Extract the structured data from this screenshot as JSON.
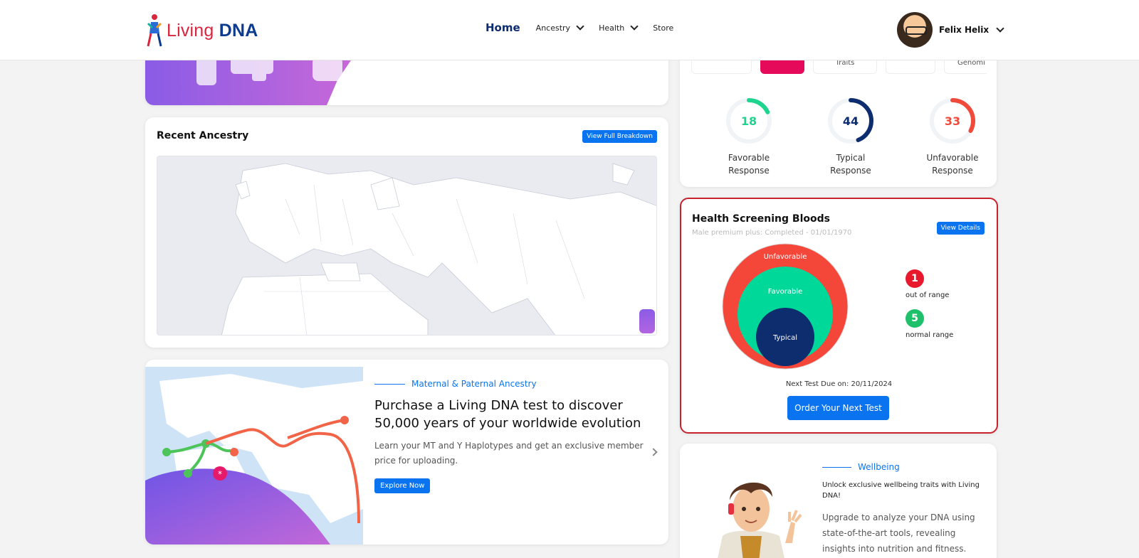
{
  "brand": {
    "word1": "Living",
    "word2": "DNA"
  },
  "nav": {
    "home": "Home",
    "ancestry": "Ancestry",
    "health": "Health",
    "store": "Store"
  },
  "user": {
    "name": "Felix Helix"
  },
  "recent_ancestry": {
    "title": "Recent Ancestry",
    "button": "View Full Breakdown"
  },
  "maternal": {
    "eyebrow": "Maternal & Paternal Ancestry",
    "title": "Purchase a Living DNA test to discover 50,000 years of your worldwide evolution",
    "description": "Learn your MT and Y Haplotypes and get an exclusive member price for uploading.",
    "button": "Explore Now"
  },
  "responses": {
    "tabs": [
      "",
      "",
      "Traits",
      "",
      "Genomi"
    ],
    "items": [
      {
        "value": "18",
        "label_line1": "Favorable",
        "label_line2": "Response",
        "color": "#1ed48f",
        "fraction": 0.18
      },
      {
        "value": "44",
        "label_line1": "Typical",
        "label_line2": "Response",
        "color": "#0d2d6e",
        "fraction": 0.44
      },
      {
        "value": "33",
        "label_line1": "Unfavorable",
        "label_line2": "Response",
        "color": "#f04a3b",
        "fraction": 0.33
      }
    ]
  },
  "health_screening": {
    "title": "Health Screening Bloods",
    "subtitle": "Male premium plus: Completed - 01/01/1970",
    "button": "View Details",
    "circles": {
      "outer": "Unfavorable",
      "middle": "Favorable",
      "inner": "Typical"
    },
    "out_of_range": {
      "count": "1",
      "label": "out of range",
      "color": "#e8192c"
    },
    "normal_range": {
      "count": "5",
      "label": "normal range",
      "color": "#1fc06b"
    },
    "next_test": "Next Test Due on: 20/11/2024",
    "order_button": "Order Your Next Test"
  },
  "wellbeing": {
    "eyebrow": "Wellbeing",
    "lead": "Unlock exclusive wellbeing traits with Living DNA!",
    "description": "Upgrade to analyze your DNA using state-of-the-art tools, revealing insights into nutrition and fitness."
  }
}
